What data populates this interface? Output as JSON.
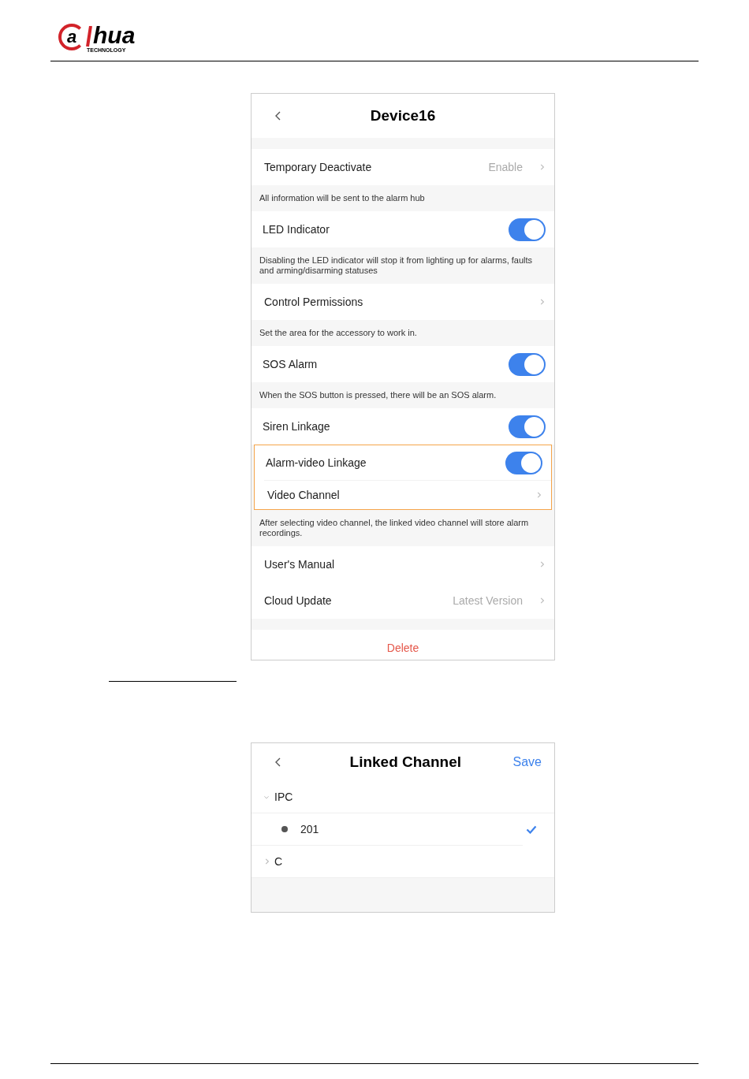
{
  "logo": {
    "mark": "a",
    "name": "hua",
    "tagline": "TECHNOLOGY"
  },
  "device_screen": {
    "title": "Device16",
    "items": [
      {
        "kind": "gap"
      },
      {
        "kind": "nav",
        "label": "Temporary Deactivate",
        "value": "Enable"
      },
      {
        "kind": "note",
        "text": "All information will be sent to the alarm hub"
      },
      {
        "kind": "toggle",
        "label": "LED Indicator",
        "on": true
      },
      {
        "kind": "note",
        "text": "Disabling the LED indicator will stop it from lighting up for alarms, faults and arming/disarming statuses"
      },
      {
        "kind": "nav",
        "label": "Control Permissions"
      },
      {
        "kind": "note",
        "text": "Set the area for the accessory to work in."
      },
      {
        "kind": "toggle",
        "label": "SOS Alarm",
        "on": true
      },
      {
        "kind": "note",
        "text": "When the SOS button is pressed, there will be an SOS alarm."
      },
      {
        "kind": "toggle",
        "label": "Siren Linkage",
        "on": true
      },
      {
        "kind": "highlight",
        "rows": [
          {
            "kind": "toggle",
            "label": "Alarm-video Linkage",
            "on": true
          },
          {
            "kind": "nav",
            "label": "Video Channel"
          }
        ]
      },
      {
        "kind": "note",
        "text": "After selecting video channel, the linked video channel will store alarm recordings."
      },
      {
        "kind": "nav",
        "label": "User's Manual"
      },
      {
        "kind": "nav",
        "label": "Cloud Update",
        "value": "Latest Version"
      },
      {
        "kind": "gap"
      },
      {
        "kind": "danger",
        "label": "Delete"
      }
    ]
  },
  "channel_screen": {
    "title": "Linked Channel",
    "action": "Save",
    "groups": [
      {
        "label": "IPC",
        "expanded": true,
        "children": [
          {
            "label": "201",
            "selected": true
          }
        ]
      },
      {
        "label": "C",
        "expanded": false
      }
    ]
  }
}
